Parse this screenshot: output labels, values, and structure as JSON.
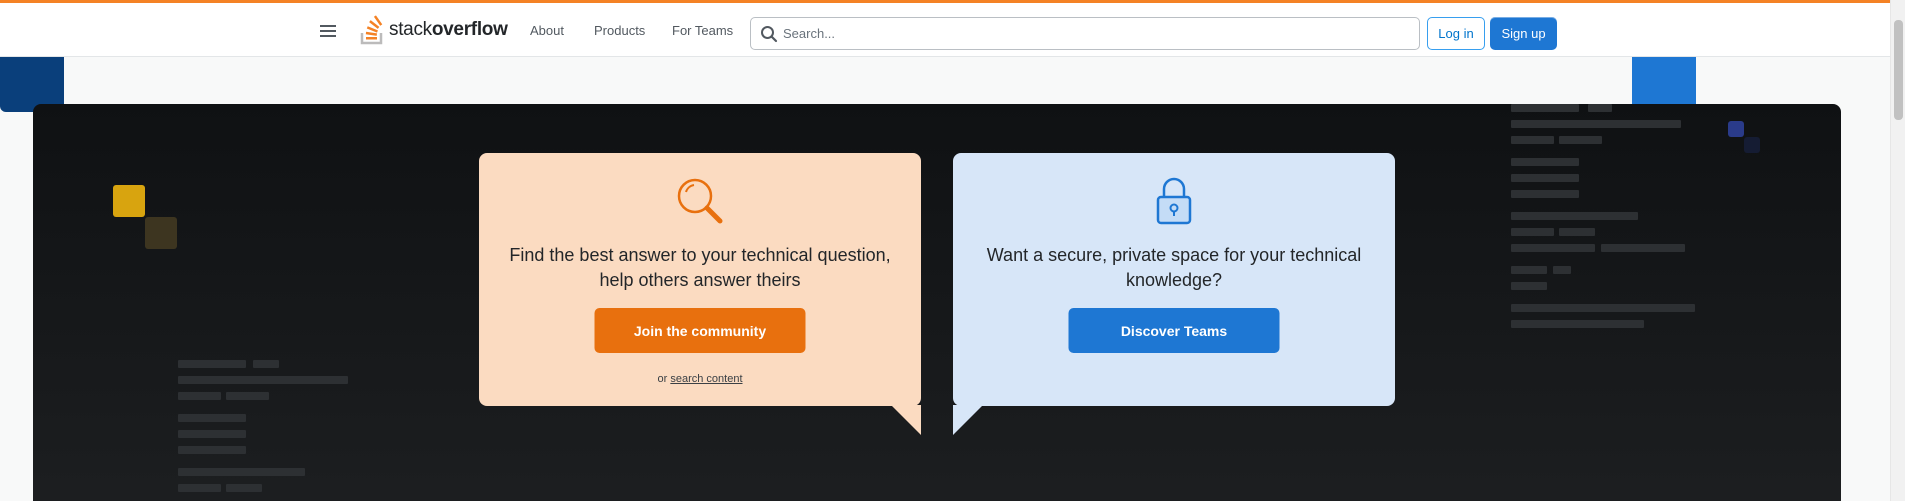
{
  "header": {
    "logo": {
      "text_light": "stack",
      "text_bold": "overflow",
      "icon": "stack-overflow-logo-icon"
    },
    "nav": [
      "About",
      "Products",
      "For Teams"
    ],
    "search": {
      "placeholder": "Search...",
      "value": "",
      "icon": "search-icon"
    },
    "login_label": "Log in",
    "signup_label": "Sign up",
    "accent_color": "#f48225"
  },
  "hero": {
    "community_card": {
      "icon": "magnifying-glass-icon",
      "text": "Find the best answer to your technical question, help others answer theirs",
      "button_label": "Join the community",
      "sub_prefix": "or",
      "sub_link": "search content",
      "color": "#fbdbc1",
      "button_color": "#e8700e"
    },
    "teams_card": {
      "icon": "padlock-icon",
      "text": "Want a secure, private space for your technical knowledge?",
      "button_label": "Discover Teams",
      "color": "#d7e6f8",
      "button_color": "#1e77d3"
    }
  }
}
